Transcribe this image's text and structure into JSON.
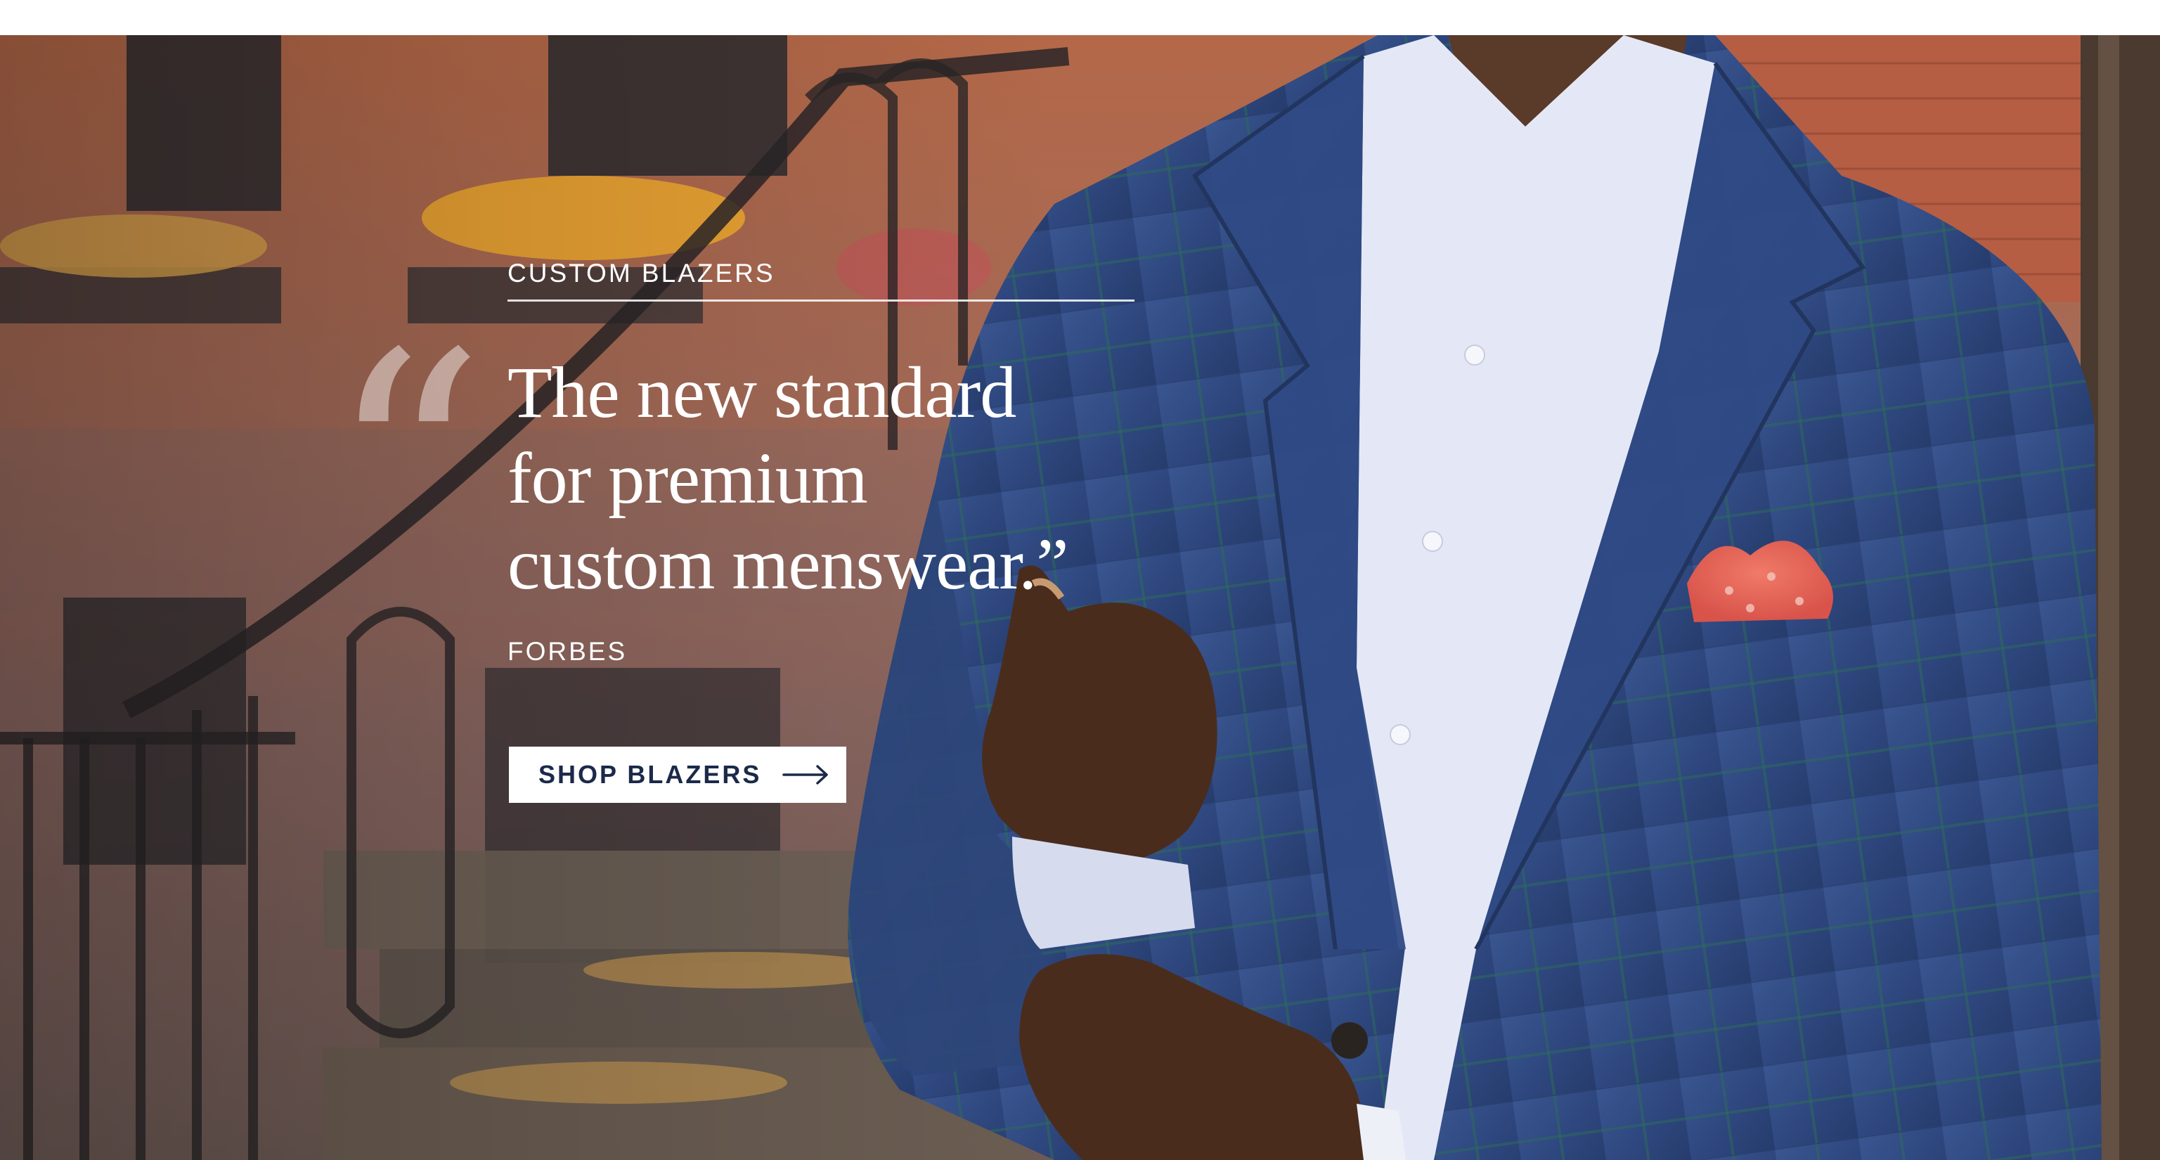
{
  "hero": {
    "eyebrow": "CUSTOM BLAZERS",
    "quote_mark": "“",
    "headline_lines": [
      "The new standard",
      "for premium",
      "custom menswear.”"
    ],
    "attribution": "FORBES",
    "cta_label": "SHOP BLAZERS",
    "cta_icon": "arrow-right-icon"
  },
  "colors": {
    "brand_navy": "#1b2a4a",
    "blazer_blue": "#34508c",
    "pocket_square": "#e46656",
    "brick": "#b96a4d"
  }
}
